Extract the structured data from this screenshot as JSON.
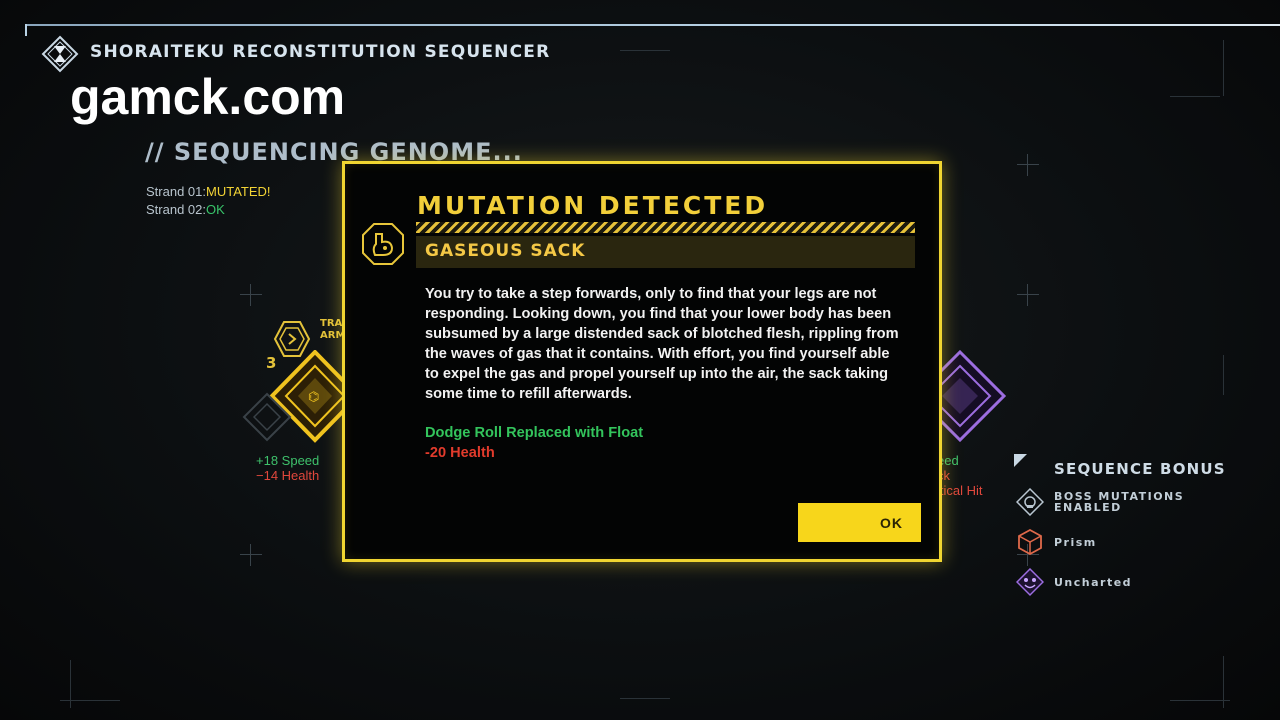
{
  "header": {
    "app_title": "SHORAITEKU RECONSTITUTION SEQUENCER",
    "logo_icon": "hourglass-diamond-icon"
  },
  "watermark": "gamck.com",
  "sequencing": {
    "title": "// SEQUENCING GENOME...",
    "strands": [
      {
        "label": "Strand 01:",
        "status": "MUTATED!"
      },
      {
        "label": "Strand 02:",
        "status": "OK"
      }
    ]
  },
  "left_node": {
    "level": "3",
    "tag_line1": "TRA",
    "tag_line2": "ARM",
    "stat_green": "+18 Speed",
    "stat_red": "−14 Health"
  },
  "right_node": {
    "stat_line1": "eed",
    "stat_line2": "ck",
    "stat_line3": "itical Hit"
  },
  "modal": {
    "title": "MUTATION DETECTED",
    "subtitle": "GASEOUS SACK",
    "body": "You try to take a step forwards, only to find that your legs are not responding. Looking down, you find that your lower body has been subsumed by a large distended sack of blotched flesh, rippling from the waves of gas that it contains. With effort, you find yourself able to expel the gas and propel yourself up into the air, the sack taking some time to refill afterwards.",
    "effect_positive": "Dodge Roll Replaced with Float",
    "effect_negative": "-20 Health",
    "ok_label": "OK",
    "icon": "gaseous-sack-icon"
  },
  "sequence_bonus": {
    "title": "SEQUENCE BONUS",
    "items": [
      {
        "line1": "BOSS MUTATIONS",
        "line2": "ENABLED",
        "icon": "boss-skull-icon",
        "color": "#b9c6d1"
      },
      {
        "line1": "Prism",
        "line2": "",
        "icon": "prism-cube-icon",
        "color": "#e0694a"
      },
      {
        "line1": "Uncharted",
        "line2": "",
        "icon": "uncharted-creature-icon",
        "color": "#9c6de0"
      }
    ]
  },
  "colors": {
    "accent_yellow": "#f0d531",
    "positive_green": "#33c45c",
    "negative_red": "#e23b2c",
    "purple": "#9c6de0"
  }
}
